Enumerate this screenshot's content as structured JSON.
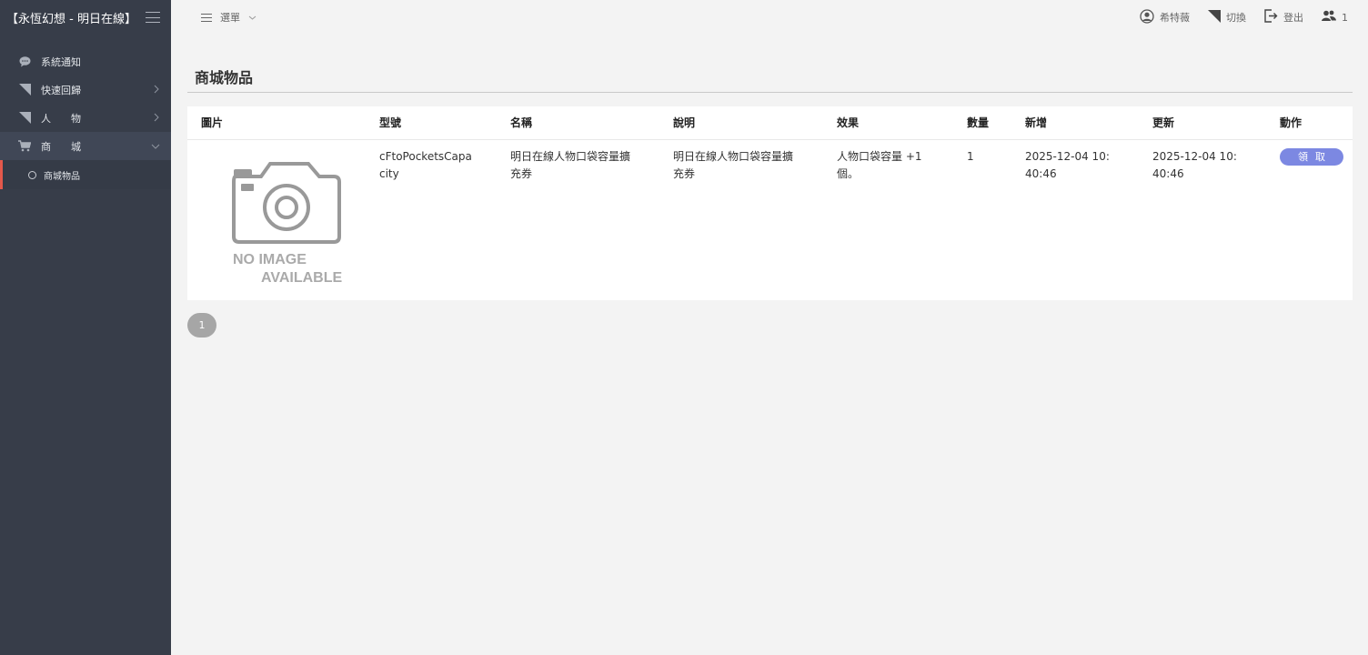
{
  "sidebar": {
    "brand": "【永恆幻想 - 明日在線】",
    "items": [
      {
        "label": "系統通知",
        "icon": "chat-bubble-icon"
      },
      {
        "label": "快速回歸",
        "icon": "triangle-icon"
      },
      {
        "label": "人　　物",
        "icon": "triangle-icon"
      },
      {
        "label": "商　　城",
        "icon": "cart-icon"
      }
    ],
    "subitem": "商城物品"
  },
  "topbar": {
    "menu_label": "選單",
    "user_name": "希特薇",
    "switch_label": "切換",
    "logout_label": "登出",
    "online_count": "1"
  },
  "page": {
    "title": "商城物品"
  },
  "table": {
    "headers": [
      "圖片",
      "型號",
      "名稱",
      "說明",
      "效果",
      "數量",
      "新增",
      "更新",
      "動作"
    ],
    "rows": [
      {
        "image_text_1": "NO IMAGE",
        "image_text_2": "AVAILABLE",
        "model": "cFtoPocketsCapacity",
        "name": "明日在線人物口袋容量擴充券",
        "description": "明日在線人物口袋容量擴充券",
        "effect": "人物口袋容量 +1 個。",
        "quantity": "1",
        "created": "2025-12-04 10:40:46",
        "updated": "2025-12-04 10:40:46",
        "action": "領取"
      }
    ]
  },
  "pagination": {
    "current": "1"
  },
  "colors": {
    "sidebar_bg": "#373d49",
    "accent_active": "#e4584b",
    "button_bg": "#7c88e2"
  }
}
